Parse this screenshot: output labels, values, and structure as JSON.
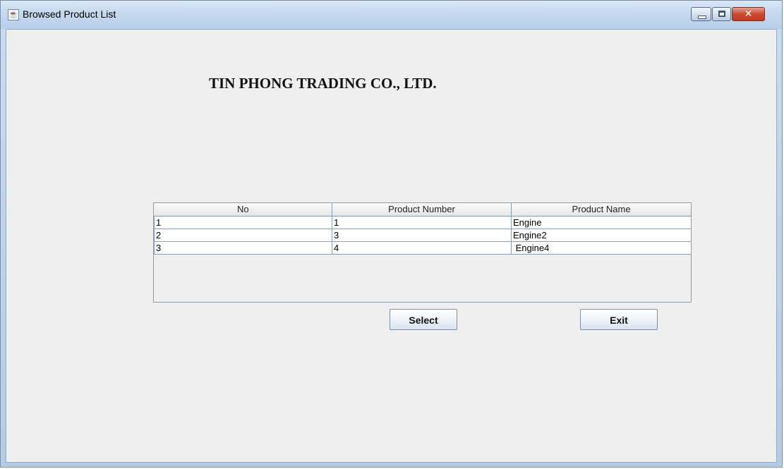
{
  "window": {
    "title": "Browsed Product List",
    "icon": "java-cup-icon",
    "controls": [
      "minimize-icon",
      "maximize-icon",
      "close-icon"
    ]
  },
  "header": {
    "company": "TIN PHONG TRADING CO., LTD."
  },
  "table": {
    "columns": [
      "No",
      "Product Number",
      "Product Name"
    ],
    "rows": [
      [
        "1",
        "1",
        "Engine"
      ],
      [
        "2",
        "3",
        "Engine2"
      ],
      [
        "3",
        "4",
        " Engine4"
      ]
    ]
  },
  "buttons": {
    "select": "Select",
    "exit": "Exit"
  },
  "colors": {
    "window_background": "#efefef",
    "close_button": "#cc4a2f"
  }
}
